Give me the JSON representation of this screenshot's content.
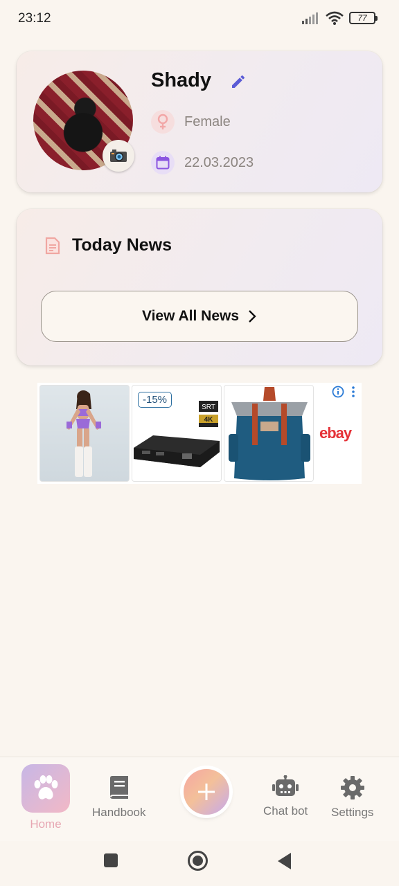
{
  "status_bar": {
    "time": "23:12",
    "battery": "77"
  },
  "profile": {
    "name": "Shady",
    "gender": "Female",
    "birth_date": "22.03.2023"
  },
  "news": {
    "title": "Today News",
    "view_all_label": "View All News"
  },
  "ad": {
    "discount_badge": "-15%",
    "brand": "ebay",
    "product_labels": [
      "SRT",
      "4K"
    ]
  },
  "bottom_nav": {
    "items": [
      {
        "label": "Home",
        "icon": "paw-icon",
        "active": true
      },
      {
        "label": "Handbook",
        "icon": "book-icon",
        "active": false
      },
      {
        "label": "",
        "icon": "plus-icon",
        "active": false
      },
      {
        "label": "Chat bot",
        "icon": "robot-icon",
        "active": false
      },
      {
        "label": "Settings",
        "icon": "gear-icon",
        "active": false
      }
    ]
  },
  "colors": {
    "background": "#faf5ef",
    "edit_accent": "#5b5bd6",
    "gender_accent": "#f2a7a7",
    "date_accent": "#8b55e0",
    "active_nav_label": "#e7a7b3"
  }
}
